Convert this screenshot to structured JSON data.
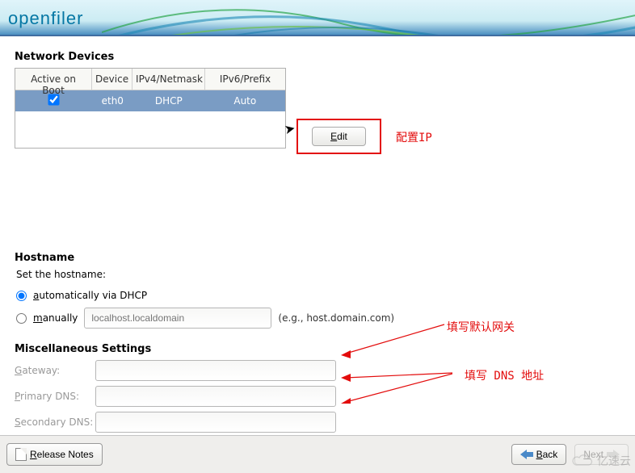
{
  "logo": "openfiler",
  "sections": {
    "devices_title": "Network Devices",
    "hostname_title": "Hostname",
    "misc_title": "Miscellaneous Settings"
  },
  "table": {
    "headers": {
      "active": "Active on Boot",
      "device": "Device",
      "ipv4": "IPv4/Netmask",
      "ipv6": "IPv6/Prefix"
    },
    "rows": [
      {
        "active": true,
        "device": "eth0",
        "ipv4": "DHCP",
        "ipv6": "Auto"
      }
    ]
  },
  "edit_button": "Edit",
  "edit_mnemonic": "E",
  "edit_annotation": "配置IP",
  "hostname": {
    "instruction": "Set the hostname:",
    "auto_label": "automatically via DHCP",
    "auto_mnemonic": "a",
    "manual_label": "manually",
    "manual_mnemonic": "m",
    "placeholder": "localhost.localdomain",
    "example": "(e.g., host.domain.com)"
  },
  "misc": {
    "gateway_label": "Gateway:",
    "gateway_mnemonic": "G",
    "primary_dns_label": "Primary DNS:",
    "primary_dns_mnemonic": "P",
    "secondary_dns_label": "Secondary DNS:",
    "secondary_dns_mnemonic": "S",
    "gateway_annot": "填写默认网关",
    "dns_annot": "填写 DNS 地址"
  },
  "footer": {
    "release_notes": "Release Notes",
    "release_mnemonic": "R",
    "back": "Back",
    "back_mnemonic": "B",
    "next": "Next",
    "next_mnemonic": "N"
  },
  "watermark": "亿速云"
}
